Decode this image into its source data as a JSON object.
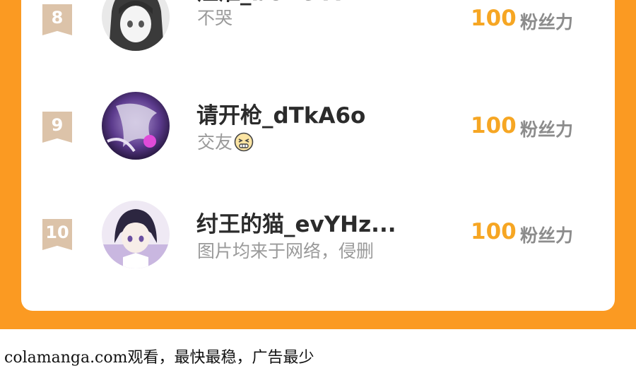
{
  "leaderboard": {
    "rows": [
      {
        "rank": "8",
        "name": "江淮_bUVeIA",
        "subtitle": "不哭",
        "score": "100",
        "unit": "粉丝力"
      },
      {
        "rank": "9",
        "name": "请开枪_dTkA6o",
        "subtitle": "交友",
        "score": "100",
        "unit": "粉丝力"
      },
      {
        "rank": "10",
        "name": "纣王的猫_evYHz...",
        "subtitle": "图片均来于网络，侵删",
        "score": "100",
        "unit": "粉丝力"
      }
    ]
  },
  "footer": {
    "text": "colamanga.com观看，最快最稳，广告最少"
  },
  "colors": {
    "accent_orange": "#fb9a22",
    "score_yellow": "#f6a623",
    "rank_badge": "#dcc3a9"
  }
}
